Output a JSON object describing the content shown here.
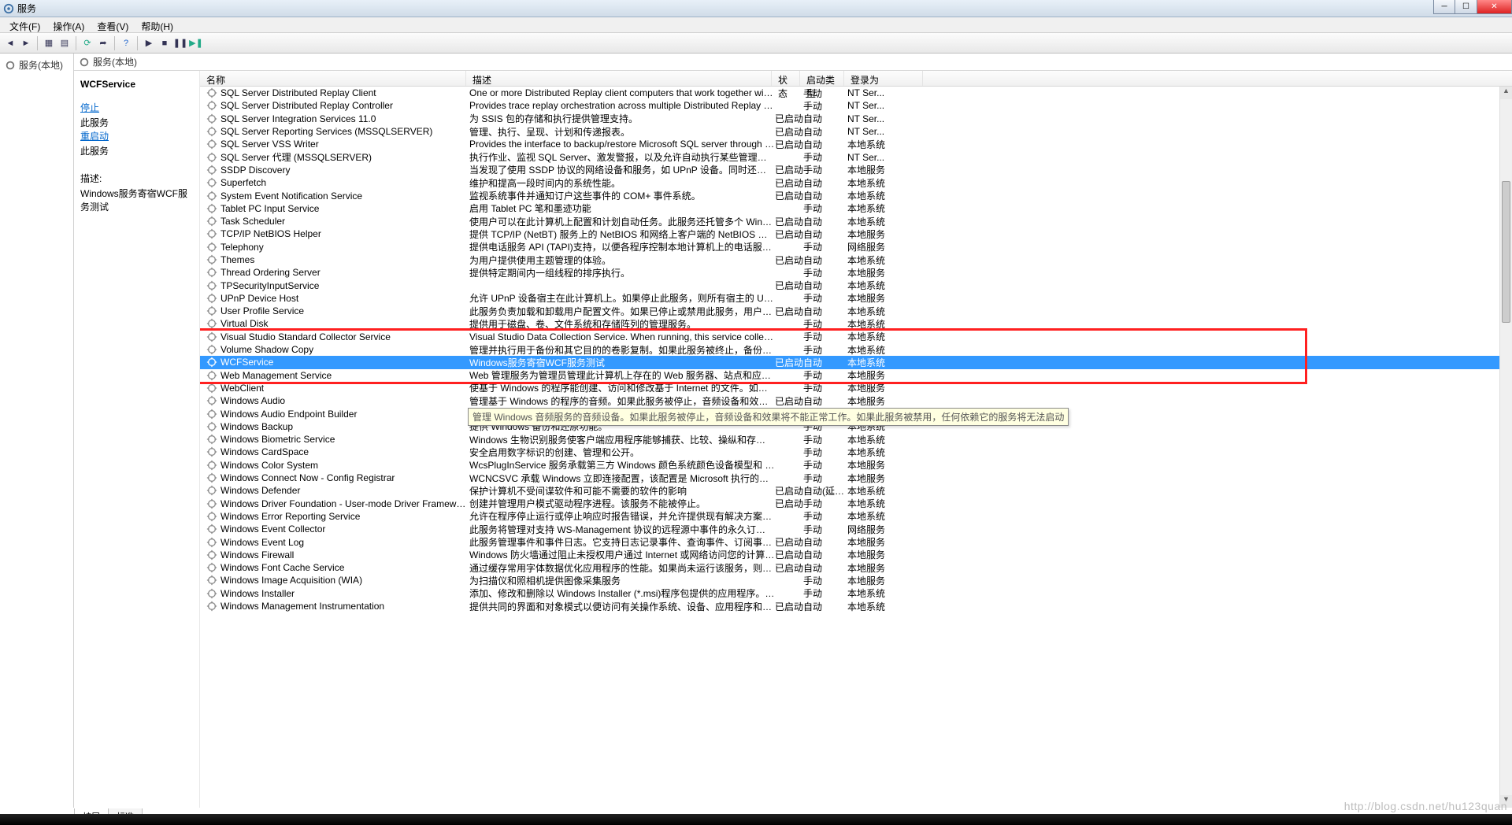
{
  "window": {
    "title": "服务"
  },
  "menu": {
    "file": "文件(F)",
    "action": "操作(A)",
    "view": "查看(V)",
    "help": "帮助(H)"
  },
  "nav": {
    "root": "服务(本地)"
  },
  "addr": {
    "label": "服务(本地)"
  },
  "detail": {
    "name": "WCFService",
    "stop": "停止",
    "stop_suffix": "此服务",
    "restart": "重启动",
    "restart_suffix": "此服务",
    "desc_label": "描述:",
    "desc": "Windows服务寄宿WCF服务测试"
  },
  "columns": {
    "name": "名称",
    "desc": "描述",
    "status": "状态",
    "type": "启动类型",
    "logon": "登录为"
  },
  "tooltip": "管理 Windows 音频服务的音频设备。如果此服务被停止，音频设备和效果将不能正常工作。如果此服务被禁用，任何依赖它的服务将无法启动",
  "tabs": {
    "ext": "扩展",
    "std": "标准"
  },
  "watermark": "http://blog.csdn.net/hu123quan",
  "highlight_range": [
    19,
    22
  ],
  "selected_index": 21,
  "tooltip_row": 25,
  "services": [
    {
      "n": "SQL Server Distributed Replay Client",
      "d": "One or more Distributed Replay client computers that work together with a Distri...",
      "s": "",
      "t": "手动",
      "l": "NT Ser..."
    },
    {
      "n": "SQL Server Distributed Replay Controller",
      "d": "Provides trace replay orchestration across multiple Distributed Replay client com...",
      "s": "",
      "t": "手动",
      "l": "NT Ser..."
    },
    {
      "n": "SQL Server Integration Services 11.0",
      "d": "为 SSIS 包的存储和执行提供管理支持。",
      "s": "已启动",
      "t": "自动",
      "l": "NT Ser..."
    },
    {
      "n": "SQL Server Reporting Services (MSSQLSERVER)",
      "d": "管理、执行、呈现、计划和传递报表。",
      "s": "已启动",
      "t": "自动",
      "l": "NT Ser..."
    },
    {
      "n": "SQL Server VSS Writer",
      "d": "Provides the interface to backup/restore Microsoft SQL server through the Windo...",
      "s": "已启动",
      "t": "自动",
      "l": "本地系统"
    },
    {
      "n": "SQL Server 代理 (MSSQLSERVER)",
      "d": "执行作业、监视 SQL Server、激发警报，以及允许自动执行某些管理任务。",
      "s": "",
      "t": "手动",
      "l": "NT Ser..."
    },
    {
      "n": "SSDP Discovery",
      "d": "当发现了使用 SSDP 协议的网络设备和服务，如 UPnP 设备。同时还报告了运行在本地计...",
      "s": "已启动",
      "t": "手动",
      "l": "本地服务"
    },
    {
      "n": "Superfetch",
      "d": "维护和提高一段时间内的系统性能。",
      "s": "已启动",
      "t": "自动",
      "l": "本地系统"
    },
    {
      "n": "System Event Notification Service",
      "d": "监视系统事件并通知订户这些事件的 COM+ 事件系统。",
      "s": "已启动",
      "t": "自动",
      "l": "本地系统"
    },
    {
      "n": "Tablet PC Input Service",
      "d": "启用 Tablet PC 笔和墨迹功能",
      "s": "",
      "t": "手动",
      "l": "本地系统"
    },
    {
      "n": "Task Scheduler",
      "d": "使用户可以在此计算机上配置和计划自动任务。此服务还托管多个 Windows 系统关键任...",
      "s": "已启动",
      "t": "自动",
      "l": "本地系统"
    },
    {
      "n": "TCP/IP NetBIOS Helper",
      "d": "提供 TCP/IP (NetBT) 服务上的 NetBIOS 和网络上客户端的 NetBIOS 名称解析的支持，...",
      "s": "已启动",
      "t": "自动",
      "l": "本地服务"
    },
    {
      "n": "Telephony",
      "d": "提供电话服务 API (TAPI)支持，以便各程序控制本地计算机上的电话服务设备以及通过 LA...",
      "s": "",
      "t": "手动",
      "l": "网络服务"
    },
    {
      "n": "Themes",
      "d": "为用户提供使用主题管理的体验。",
      "s": "已启动",
      "t": "自动",
      "l": "本地系统"
    },
    {
      "n": "Thread Ordering Server",
      "d": "提供特定期间内一组线程的排序执行。",
      "s": "",
      "t": "手动",
      "l": "本地服务"
    },
    {
      "n": "TPSecurityInputService",
      "d": "",
      "s": "已启动",
      "t": "自动",
      "l": "本地系统"
    },
    {
      "n": "UPnP Device Host",
      "d": "允许 UPnP 设备宿主在此计算机上。如果停止此服务，则所有宿主的 UPnP 设备都将停止...",
      "s": "",
      "t": "手动",
      "l": "本地服务"
    },
    {
      "n": "User Profile Service",
      "d": "此服务负责加载和卸载用户配置文件。如果已停止或禁用此服务，用户将无法再成功登录...",
      "s": "已启动",
      "t": "自动",
      "l": "本地系统"
    },
    {
      "n": "Virtual Disk",
      "d": "提供用于磁盘、卷、文件系统和存储阵列的管理服务。",
      "s": "",
      "t": "手动",
      "l": "本地系统"
    },
    {
      "n": "Visual Studio Standard Collector Service",
      "d": "Visual Studio Data Collection Service. When running, this service collects real ti...",
      "s": "",
      "t": "手动",
      "l": "本地系统"
    },
    {
      "n": "Volume Shadow Copy",
      "d": "管理并执行用于备份和其它目的的卷影复制。如果此服务被终止，备份将没有卷影复制，...",
      "s": "",
      "t": "手动",
      "l": "本地系统"
    },
    {
      "n": "WCFService",
      "d": "Windows服务寄宿WCF服务测试",
      "s": "已启动",
      "t": "自动",
      "l": "本地系统"
    },
    {
      "n": "Web Management Service",
      "d": "Web 管理服务为管理员管理此计算机上存在的 Web 服务器、站点和应用程序提供了远程...",
      "s": "",
      "t": "手动",
      "l": "本地服务"
    },
    {
      "n": "WebClient",
      "d": "使基于 Windows 的程序能创建、访问和修改基于 Internet 的文件。如果此服务被停止，...",
      "s": "",
      "t": "手动",
      "l": "本地服务"
    },
    {
      "n": "Windows Audio",
      "d": "管理基于 Windows 的程序的音频。如果此服务被停止，音频设备和效果将不能正常工作...",
      "s": "已启动",
      "t": "自动",
      "l": "本地服务"
    },
    {
      "n": "Windows Audio Endpoint Builder",
      "d": "",
      "s": "",
      "t": "",
      "l": ""
    },
    {
      "n": "Windows Backup",
      "d": "提供 Windows 备份和还原功能。",
      "s": "",
      "t": "手动",
      "l": "本地系统"
    },
    {
      "n": "Windows Biometric Service",
      "d": "Windows 生物识别服务使客户端应用程序能够捕获、比较、操纵和存储生物特征数据，而...",
      "s": "",
      "t": "手动",
      "l": "本地系统"
    },
    {
      "n": "Windows CardSpace",
      "d": "安全启用数字标识的创建、管理和公开。",
      "s": "",
      "t": "手动",
      "l": "本地系统"
    },
    {
      "n": "Windows Color System",
      "d": "WcsPlugInService 服务承载第三方 Windows 颜色系统颜色设备模型和 gamut 映射模型...",
      "s": "",
      "t": "手动",
      "l": "本地服务"
    },
    {
      "n": "Windows Connect Now - Config Registrar",
      "d": "WCNCSVC 承载 Windows 立即连接配置，该配置是 Microsoft 执行的受 Wi-Fi 保护的...",
      "s": "",
      "t": "手动",
      "l": "本地服务"
    },
    {
      "n": "Windows Defender",
      "d": "保护计算机不受间谍软件和可能不需要的软件的影响",
      "s": "已启动",
      "t": "自动(延迟...",
      "l": "本地系统"
    },
    {
      "n": "Windows Driver Foundation - User-mode Driver Framework",
      "d": "创建并管理用户模式驱动程序进程。该服务不能被停止。",
      "s": "已启动",
      "t": "手动",
      "l": "本地系统"
    },
    {
      "n": "Windows Error Reporting Service",
      "d": "允许在程序停止运行或停止响应时报告错误，并允许提供现有解决方案。还允许为诊断和...",
      "s": "",
      "t": "手动",
      "l": "本地系统"
    },
    {
      "n": "Windows Event Collector",
      "d": "此服务将管理对支持 WS-Management 协议的远程源中事件的永久订阅。这包括 Wind...",
      "s": "",
      "t": "手动",
      "l": "网络服务"
    },
    {
      "n": "Windows Event Log",
      "d": "此服务管理事件和事件日志。它支持日志记录事件、查询事件、订阅事件、归档事件日志...",
      "s": "已启动",
      "t": "自动",
      "l": "本地服务"
    },
    {
      "n": "Windows Firewall",
      "d": "Windows 防火墙通过阻止未授权用户通过 Internet 或网络访问您的计算机来帮助保护计...",
      "s": "已启动",
      "t": "自动",
      "l": "本地服务"
    },
    {
      "n": "Windows Font Cache Service",
      "d": "通过缓存常用字体数据优化应用程序的性能。如果尚未运行该服务，则应用程序将启动该...",
      "s": "已启动",
      "t": "自动",
      "l": "本地服务"
    },
    {
      "n": "Windows Image Acquisition (WIA)",
      "d": "为扫描仪和照相机提供图像采集服务",
      "s": "",
      "t": "手动",
      "l": "本地服务"
    },
    {
      "n": "Windows Installer",
      "d": "添加、修改和删除以 Windows Installer (*.msi)程序包提供的应用程序。如果禁用了此服...",
      "s": "",
      "t": "手动",
      "l": "本地系统"
    },
    {
      "n": "Windows Management Instrumentation",
      "d": "提供共同的界面和对象模式以便访问有关操作系统、设备、应用程序和服务的管理信息。...",
      "s": "已启动",
      "t": "自动",
      "l": "本地系统"
    }
  ]
}
